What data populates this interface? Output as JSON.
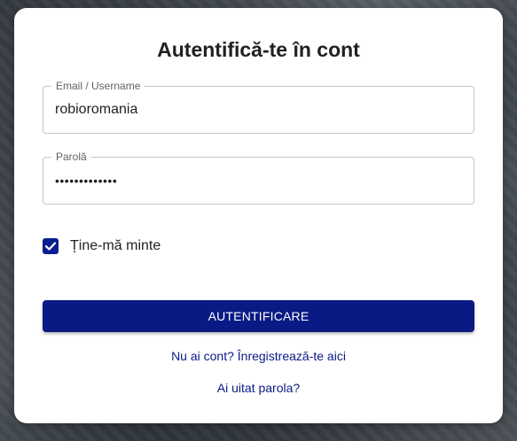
{
  "login": {
    "title": "Autentifică-te în cont",
    "email": {
      "label": "Email / Username",
      "value": "robioromania"
    },
    "password": {
      "label": "Parolă",
      "value": "•••••••••••••"
    },
    "remember": {
      "label": "Ține-mă minte",
      "checked": true
    },
    "submit_label": "AUTENTIFICARE",
    "register_link": "Nu ai cont? Înregistrează-te aici",
    "forgot_link": "Ai uitat parola?"
  },
  "colors": {
    "primary": "#0a1a84",
    "card": "#ffffff"
  }
}
